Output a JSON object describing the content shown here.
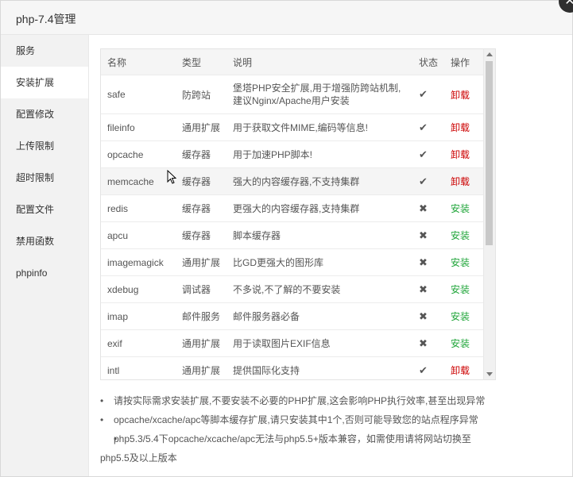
{
  "window": {
    "title": "php-7.4管理",
    "close_glyph": "✕"
  },
  "sidebar": {
    "items": [
      {
        "label": "服务"
      },
      {
        "label": "安装扩展",
        "active": true
      },
      {
        "label": "配置修改"
      },
      {
        "label": "上传限制"
      },
      {
        "label": "超时限制"
      },
      {
        "label": "配置文件"
      },
      {
        "label": "禁用函数"
      },
      {
        "label": "phpinfo"
      }
    ]
  },
  "table": {
    "headers": {
      "name": "名称",
      "type": "类型",
      "desc": "说明",
      "status": "状态",
      "action": "操作"
    },
    "rows": [
      {
        "name": "safe",
        "type": "防跨站",
        "desc": "堡塔PHP安全扩展,用于增强防跨站机制,建议Nginx/Apache用户安装",
        "status": "✔",
        "action": "卸载"
      },
      {
        "name": "fileinfo",
        "type": "通用扩展",
        "desc": "用于获取文件MIME,编码等信息!",
        "status": "✔",
        "action": "卸载"
      },
      {
        "name": "opcache",
        "type": "缓存器",
        "desc": "用于加速PHP脚本!",
        "status": "✔",
        "action": "卸载"
      },
      {
        "name": "memcache",
        "type": "缓存器",
        "desc": "强大的内容缓存器,不支持集群",
        "status": "✔",
        "action": "卸载"
      },
      {
        "name": "redis",
        "type": "缓存器",
        "desc": "更强大的内容缓存器,支持集群",
        "status": "✖",
        "action": "安装"
      },
      {
        "name": "apcu",
        "type": "缓存器",
        "desc": "脚本缓存器",
        "status": "✖",
        "action": "安装"
      },
      {
        "name": "imagemagick",
        "type": "通用扩展",
        "desc": "比GD更强大的图形库",
        "status": "✖",
        "action": "安装"
      },
      {
        "name": "xdebug",
        "type": "调试器",
        "desc": "不多说,不了解的不要安装",
        "status": "✖",
        "action": "安装"
      },
      {
        "name": "imap",
        "type": "邮件服务",
        "desc": "邮件服务器必备",
        "status": "✖",
        "action": "安装"
      },
      {
        "name": "exif",
        "type": "通用扩展",
        "desc": "用于读取图片EXIF信息",
        "status": "✖",
        "action": "安装"
      },
      {
        "name": "intl",
        "type": "通用扩展",
        "desc": "提供国际化支持",
        "status": "✔",
        "action": "卸载"
      }
    ]
  },
  "notes": [
    "请按实际需求安装扩展,不要安装不必要的PHP扩展,这会影响PHP执行效率,甚至出现异常",
    "opcache/xcache/apc等脚本缓存扩展,请只安装其中1个,否则可能导致您的站点程序异常",
    "php5.3/5.4下opcache/xcache/apc无法与php5.5+版本兼容，如需使用请将网站切换至php5.5及以上版本"
  ],
  "colors": {
    "uninstall": "#cc0000",
    "install": "#20a53a"
  }
}
